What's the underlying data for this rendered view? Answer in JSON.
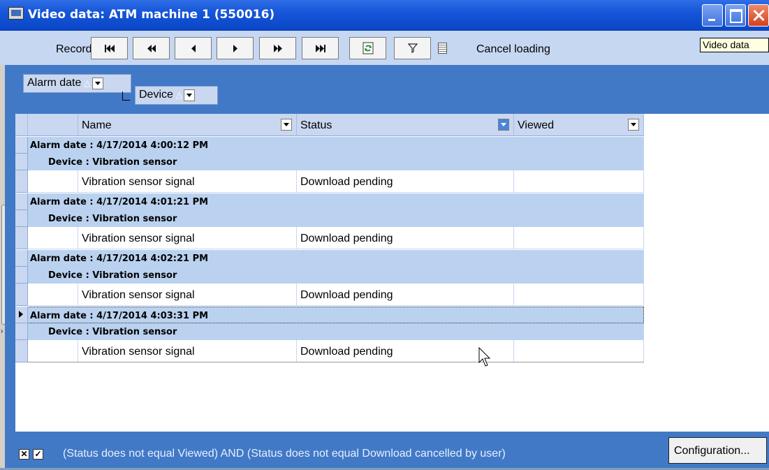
{
  "window": {
    "title": "Video data: ATM machine 1 (550016)"
  },
  "toolbar": {
    "records_label": "Records",
    "nav": [
      "⏮",
      "⏪",
      "◀",
      "▶",
      "⏩",
      "⏭"
    ],
    "cancel_label": "Cancel loading",
    "tooltip": "Video data"
  },
  "group_panel": {
    "chip1": "Alarm date",
    "chip2": "Device"
  },
  "grid": {
    "columns": [
      "Name",
      "Status",
      "Viewed"
    ],
    "groups": [
      {
        "alarm": "Alarm date : 4/17/2014 4:00:12 PM",
        "device": "Device : Vibration sensor",
        "name": "Vibration sensor signal",
        "status": "Download pending",
        "viewed": ""
      },
      {
        "alarm": "Alarm date : 4/17/2014 4:01:21 PM",
        "device": "Device : Vibration sensor",
        "name": "Vibration sensor signal",
        "status": "Download pending",
        "viewed": ""
      },
      {
        "alarm": "Alarm date : 4/17/2014 4:02:21 PM",
        "device": "Device : Vibration sensor",
        "name": "Vibration sensor signal",
        "status": "Download pending",
        "viewed": ""
      },
      {
        "alarm": "Alarm date : 4/17/2014 4:03:31 PM",
        "device": "Device : Vibration sensor",
        "name": "Vibration sensor signal",
        "status": "Download pending",
        "viewed": ""
      }
    ]
  },
  "footer": {
    "filter_text": "(Status does not equal Viewed) AND (Status does not equal Download cancelled by user)",
    "config_label": "Configuration..."
  },
  "colors": {
    "accent": "#4179c6",
    "header": "#c9d8f0",
    "group_row": "#bad2f0"
  }
}
